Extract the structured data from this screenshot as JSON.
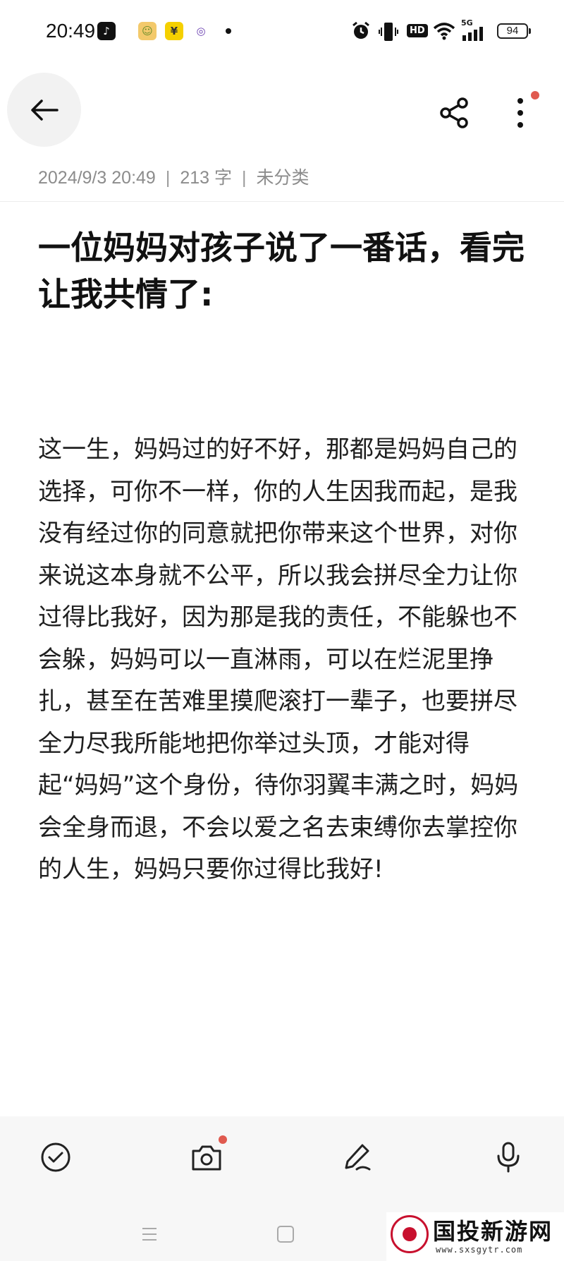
{
  "status_bar": {
    "time": "20:49",
    "network_type": "5G",
    "hd_label": "HD",
    "battery_level": "94",
    "icons": [
      "tiktok-icon",
      "app-icon",
      "yen-icon",
      "app-icon-purple",
      "alarm-icon",
      "vibrate-icon",
      "hd-icon",
      "wifi-icon",
      "signal-icon",
      "battery-icon"
    ]
  },
  "header": {
    "date": "2024/9/3 20:49",
    "word_count": "213 字",
    "category": "未分类"
  },
  "note": {
    "title": "一位妈妈对孩子说了一番话，看完让我共情了:",
    "body": "这一生，妈妈过的好不好，那都是妈妈自己的选择，可你不一样，你的人生因我而起，是我没有经过你的同意就把你带来这个世界，对你来说这本身就不公平，所以我会拼尽全力让你过得比我好，因为那是我的责任，不能躲也不会躲，妈妈可以一直淋雨，可以在烂泥里挣扎，甚至在苦难里摸爬滚打一辈子，也要拼尽全力尽我所能地把你举过头顶，才能对得起“妈妈”这个身份，待你羽翼丰满之时，妈妈会全身而退，不会以爱之名去束缚你去掌控你的人生，妈妈只要你过得比我好!"
  },
  "toolbar": {
    "items": [
      "check-icon",
      "camera-icon",
      "pen-icon",
      "microphone-icon"
    ]
  },
  "watermark": {
    "title": "国投新游网",
    "url": "www.sxsgytr.com"
  },
  "colors": {
    "accent_red": "#e05a4f",
    "meta_gray": "#8c8c8c",
    "toolbar_bg": "#f7f7f7"
  }
}
